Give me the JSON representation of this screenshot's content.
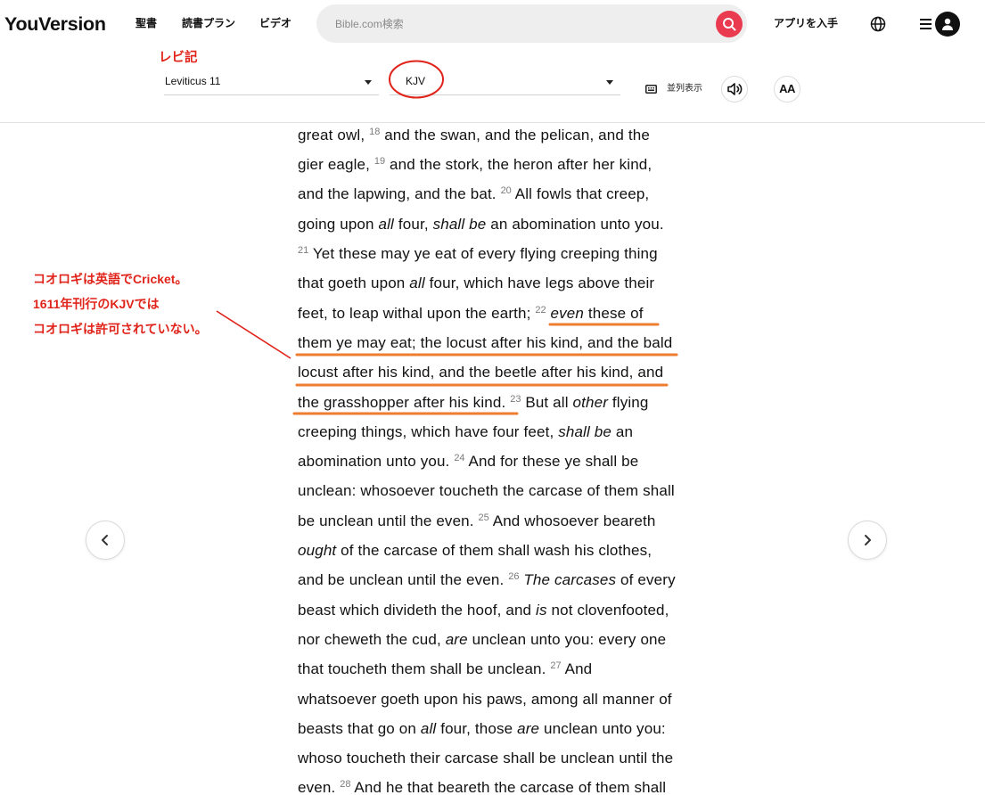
{
  "header": {
    "logo": "YouVersion",
    "nav": [
      "聖書",
      "読書プラン",
      "ビデオ"
    ],
    "search": {
      "placeholder": "Bible.com検索",
      "button_icon": "search-icon"
    },
    "get_app": "アプリを入手",
    "language_icon": "globe-icon",
    "menu_icon": "menu-icon",
    "profile_icon": "user-icon"
  },
  "toolbar": {
    "book": "Leviticus 11",
    "version": "KJV",
    "parallel": {
      "label": "並列表示",
      "icon": "parallel-icon"
    },
    "audio_icon": "speaker-icon",
    "font_settings": "AA"
  },
  "reader": {
    "lines": [
      [
        {
          "text": "great owl, "
        },
        {
          "verse": "18"
        },
        {
          "text": " and the swan, and the pelican, and the"
        }
      ],
      [
        {
          "text": "gier eagle, "
        },
        {
          "verse": "19"
        },
        {
          "text": " and the stork, the heron after her kind,"
        }
      ],
      [
        {
          "text": "and the lapwing, and the bat. "
        },
        {
          "verse": "20"
        },
        {
          "text": " All fowls that creep,"
        }
      ],
      [
        {
          "text": "going upon "
        },
        {
          "text": "all",
          "italic": true
        },
        {
          "text": " four, "
        },
        {
          "text": "shall be",
          "italic": true
        },
        {
          "text": " an abomination unto you."
        }
      ],
      [
        {
          "verse": "21"
        },
        {
          "text": " Yet these may ye eat of every flying creeping thing"
        }
      ],
      [
        {
          "text": "that goeth upon "
        },
        {
          "text": "all",
          "italic": true
        },
        {
          "text": " four, which have legs above their"
        }
      ],
      [
        {
          "text": "feet, to leap withal upon the earth; "
        },
        {
          "verse": "22"
        },
        {
          "text": " "
        },
        {
          "text": "even",
          "italic": true
        },
        {
          "text": " these of"
        }
      ],
      [
        {
          "text": "them ye may eat; the locust after his kind, and the bald"
        }
      ],
      [
        {
          "text": "locust after his kind, and the beetle after his kind, and"
        }
      ],
      [
        {
          "text": "the grasshopper after his kind. "
        },
        {
          "verse": "23"
        },
        {
          "text": " But all "
        },
        {
          "text": "other",
          "italic": true
        },
        {
          "text": " flying"
        }
      ],
      [
        {
          "text": "creeping things, which have four feet, "
        },
        {
          "text": "shall be",
          "italic": true
        },
        {
          "text": " an"
        }
      ],
      [
        {
          "text": "abomination unto you. "
        },
        {
          "verse": "24"
        },
        {
          "text": " And for these ye shall be"
        }
      ],
      [
        {
          "text": "unclean: whosoever toucheth the carcase of them shall"
        }
      ],
      [
        {
          "text": "be unclean until the even. "
        },
        {
          "verse": "25"
        },
        {
          "text": " And whosoever beareth"
        }
      ],
      [
        {
          "text": "ought",
          "italic": true
        },
        {
          "text": " of the carcase of them shall wash his clothes,"
        }
      ],
      [
        {
          "text": "and be unclean until the even. "
        },
        {
          "verse": "26"
        },
        {
          "text": " "
        },
        {
          "text": "The carcases",
          "italic": true
        },
        {
          "text": " of every"
        }
      ],
      [
        {
          "text": "beast which divideth the hoof, and "
        },
        {
          "text": "is",
          "italic": true
        },
        {
          "text": " not clovenfooted,"
        }
      ],
      [
        {
          "text": "nor cheweth the cud, "
        },
        {
          "text": "are",
          "italic": true
        },
        {
          "text": " unclean unto you: every one"
        }
      ],
      [
        {
          "text": "that toucheth them shall be unclean. "
        },
        {
          "verse": "27"
        },
        {
          "text": " And"
        }
      ],
      [
        {
          "text": "whatsoever goeth upon his paws, among all manner of"
        }
      ],
      [
        {
          "text": "beasts that go on "
        },
        {
          "text": "all",
          "italic": true
        },
        {
          "text": " four, those "
        },
        {
          "text": "are",
          "italic": true
        },
        {
          "text": " unclean unto you:"
        }
      ],
      [
        {
          "text": "whoso toucheth their carcase shall be unclean until the"
        }
      ],
      [
        {
          "text": "even. "
        },
        {
          "verse": "28"
        },
        {
          "text": " And he that beareth the carcase of them shall"
        }
      ]
    ]
  },
  "pager": {
    "prev_icon": "chevron-left-icon",
    "next_icon": "chevron-right-icon"
  },
  "annotations": {
    "book_label": "レビ記",
    "note": [
      "コオロギは英語でCricket。",
      "1611年刊行のKJVでは",
      "コオロギは許可されていない。"
    ]
  },
  "colors": {
    "brand_red": "#ea3a4f",
    "annotation_red": "#e0241b",
    "annotation_orange": "#ee7d30",
    "text": "#121212",
    "verse_number": "#7a7a7a"
  }
}
